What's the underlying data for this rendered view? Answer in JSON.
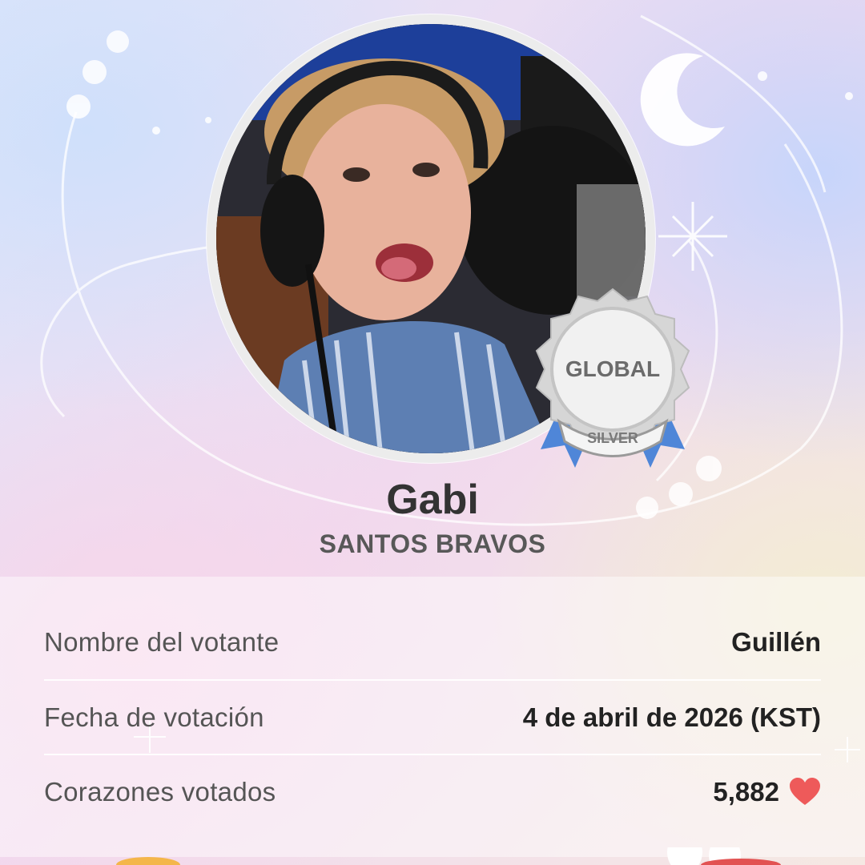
{
  "profile": {
    "name": "Gabi",
    "group": "SANTOS BRAVOS",
    "badge": {
      "top_label": "GLOBAL",
      "bottom_label": "SILVER"
    }
  },
  "details": [
    {
      "label": "Nombre del votante",
      "value": "Guillén"
    },
    {
      "label": "Fecha de votación",
      "value": "4 de abril de 2026 (KST)"
    },
    {
      "label": "Corazones votados",
      "value": "5,882",
      "icon": "heart-icon"
    }
  ],
  "colors": {
    "heart": "#ee5a5a",
    "ribbon": "#4f86d8",
    "medal": "#c9c9c9"
  }
}
